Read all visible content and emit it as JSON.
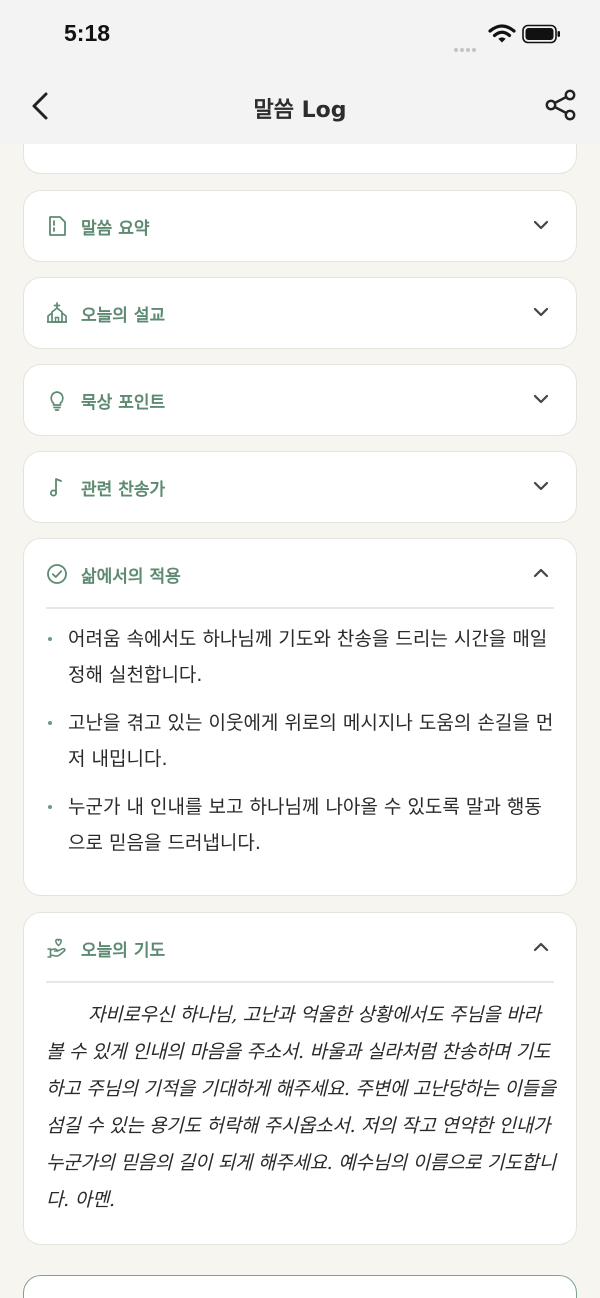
{
  "status_bar": {
    "time": "5:18"
  },
  "nav": {
    "title": "말씀 Log",
    "back_icon": "chevron-left-icon",
    "share_icon": "share-icon"
  },
  "sections": [
    {
      "title": "말씀 요약",
      "icon": "document-icon",
      "expanded": false
    },
    {
      "title": "오늘의 설교",
      "icon": "church-icon",
      "expanded": false
    },
    {
      "title": "묵상 포인트",
      "icon": "lightbulb-icon",
      "expanded": false
    },
    {
      "title": "관련 찬송가",
      "icon": "music-note-icon",
      "expanded": false
    },
    {
      "title": "삶에서의 적용",
      "icon": "check-circle-icon",
      "expanded": true,
      "items": [
        "어려움 속에서도 하나님께 기도와 찬송을 드리는 시간을 매일 정해 실천합니다.",
        "고난을 겪고 있는 이웃에게 위로의 메시지나 도움의 손길을 먼저 내밉니다.",
        "누군가 내 인내를 보고 하나님께 나아올 수 있도록 말과 행동으로 믿음을 드러냅니다."
      ]
    },
    {
      "title": "오늘의 기도",
      "icon": "praying-hand-heart-icon",
      "expanded": true,
      "body": "자비로우신 하나님, 고난과 억울한 상황에서도 주님을 바라볼 수 있게 인내의 마음을 주소서. 바울과 실라처럼 찬송하며 기도하고 주님의 기적을 기대하게 해주세요. 주변에 고난당하는 이들을 섬길 수 있는 용기도 허락해 주시옵소서. 저의 작고 연약한 인내가 누군가의 믿음의 길이 되게 해주세요. 예수님의 이름으로 기도합니다. 아멘."
    }
  ],
  "colors": {
    "accent": "#5e8a72",
    "background": "#f7f5f0",
    "card": "#ffffff"
  }
}
